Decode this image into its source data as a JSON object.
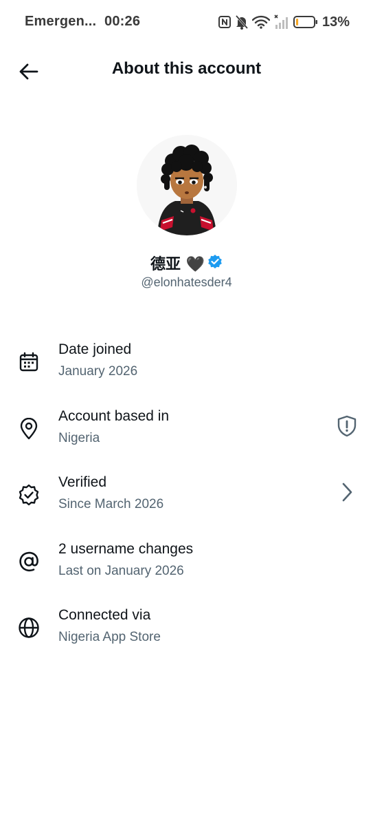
{
  "status_bar": {
    "carrier": "Emergen...",
    "time": "00:26",
    "battery_percent": "13%",
    "icons": [
      "nfc-icon",
      "bell-muted-icon",
      "wifi-icon",
      "signal-icon",
      "battery-icon"
    ]
  },
  "header": {
    "back_icon": "back-arrow-icon",
    "title": "About this account"
  },
  "profile": {
    "display_name": "德亚 🖤",
    "verified_badge": "verified-badge-icon",
    "handle": "@elonhatesder4"
  },
  "info_rows": [
    {
      "icon": "calendar-icon",
      "title": "Date joined",
      "subtitle": "January 2026"
    },
    {
      "icon": "location-pin-icon",
      "title": "Account based in",
      "subtitle": "Nigeria",
      "trailing_icon": "shield-alert-icon"
    },
    {
      "icon": "verified-check-icon",
      "title": "Verified",
      "subtitle": "Since March 2026",
      "trailing_icon": "chevron-right-icon"
    },
    {
      "icon": "at-sign-icon",
      "title": "2 username changes",
      "subtitle": "Last on January 2026"
    },
    {
      "icon": "globe-icon",
      "title": "Connected via",
      "subtitle": "Nigeria App Store"
    }
  ],
  "colors": {
    "text_primary": "#0f1419",
    "text_secondary": "#536471",
    "verified_blue": "#1d9bf0",
    "battery_fill": "#f5a623"
  }
}
